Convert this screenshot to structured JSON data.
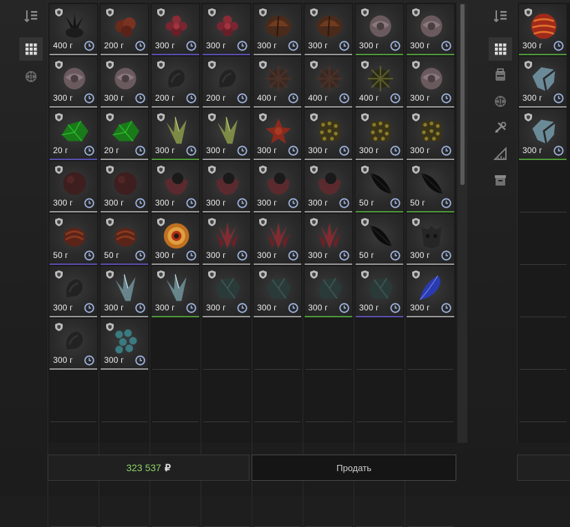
{
  "colors": {
    "background": "#1e1e1e",
    "rarity_green": "#4f9a3a",
    "rarity_purple": "#5a4fb0",
    "rarity_gray": "#9a9a9a",
    "money_green": "#8fd36a"
  },
  "left_tabs": [
    {
      "icon": "sort-icon",
      "active": false
    },
    {
      "icon": "grid-icon",
      "active": true
    },
    {
      "icon": "artifact-icon",
      "active": false
    }
  ],
  "right_tabs": [
    {
      "icon": "sort-icon",
      "active": false
    },
    {
      "icon": "grid-icon",
      "active": true
    },
    {
      "icon": "backpack-icon",
      "active": false
    },
    {
      "icon": "artifact-icon",
      "active": false
    },
    {
      "icon": "tools-icon",
      "active": false
    },
    {
      "icon": "ruler-icon",
      "active": false
    },
    {
      "icon": "box-icon",
      "active": false
    }
  ],
  "inventory": {
    "items": [
      {
        "weight": "400 г",
        "rarity": "gray",
        "art": "black-spikes"
      },
      {
        "weight": "200 г",
        "rarity": "gray",
        "art": "red-clump"
      },
      {
        "weight": "300 г",
        "rarity": "purple",
        "art": "red-flower"
      },
      {
        "weight": "300 г",
        "rarity": "purple",
        "art": "red-flower"
      },
      {
        "weight": "300 г",
        "rarity": "gray",
        "art": "orange-shell"
      },
      {
        "weight": "300 г",
        "rarity": "gray",
        "art": "orange-shell"
      },
      {
        "weight": "300 г",
        "rarity": "green",
        "art": "pale-rose"
      },
      {
        "weight": "300 г",
        "rarity": "green",
        "art": "pale-rose"
      },
      {
        "weight": "300 г",
        "rarity": "gray",
        "art": "pale-rose"
      },
      {
        "weight": "300 г",
        "rarity": "gray",
        "art": "pale-rose"
      },
      {
        "weight": "200 г",
        "rarity": "gray",
        "art": "dark-twist"
      },
      {
        "weight": "200 г",
        "rarity": "gray",
        "art": "dark-twist"
      },
      {
        "weight": "400 г",
        "rarity": "gray",
        "art": "brown-burst"
      },
      {
        "weight": "400 г",
        "rarity": "gray",
        "art": "brown-burst"
      },
      {
        "weight": "400 г",
        "rarity": "gray",
        "art": "olive-burst"
      },
      {
        "weight": "300 г",
        "rarity": "gray",
        "art": "pale-rose"
      },
      {
        "weight": "20 г",
        "rarity": "purple",
        "art": "green-crystal"
      },
      {
        "weight": "20 г",
        "rarity": "gray",
        "art": "green-crystal"
      },
      {
        "weight": "300 г",
        "rarity": "green",
        "art": "yellow-shard"
      },
      {
        "weight": "300 г",
        "rarity": "gray",
        "art": "yellow-shard"
      },
      {
        "weight": "300 г",
        "rarity": "gray",
        "art": "red-star"
      },
      {
        "weight": "300 г",
        "rarity": "gray",
        "art": "gold-nugget"
      },
      {
        "weight": "300 г",
        "rarity": "gray",
        "art": "gold-nugget"
      },
      {
        "weight": "300 г",
        "rarity": "gray",
        "art": "gold-nugget"
      },
      {
        "weight": "300 г",
        "rarity": "gray",
        "art": "maroon-ball"
      },
      {
        "weight": "300 г",
        "rarity": "gray",
        "art": "maroon-ball"
      },
      {
        "weight": "300 г",
        "rarity": "gray",
        "art": "pink-clump"
      },
      {
        "weight": "300 г",
        "rarity": "gray",
        "art": "pink-clump"
      },
      {
        "weight": "300 г",
        "rarity": "gray",
        "art": "pink-clump"
      },
      {
        "weight": "300 г",
        "rarity": "gray",
        "art": "pink-clump"
      },
      {
        "weight": "50 г",
        "rarity": "green",
        "art": "black-leaf"
      },
      {
        "weight": "50 г",
        "rarity": "green",
        "art": "black-leaf"
      },
      {
        "weight": "50 г",
        "rarity": "purple",
        "art": "red-shell"
      },
      {
        "weight": "50 г",
        "rarity": "purple",
        "art": "red-shell"
      },
      {
        "weight": "300 г",
        "rarity": "gray",
        "art": "orange-swirl"
      },
      {
        "weight": "300 г",
        "rarity": "gray",
        "art": "red-crystal"
      },
      {
        "weight": "300 г",
        "rarity": "gray",
        "art": "red-crystal"
      },
      {
        "weight": "300 г",
        "rarity": "gray",
        "art": "red-crystal"
      },
      {
        "weight": "50 г",
        "rarity": "gray",
        "art": "black-leaf"
      },
      {
        "weight": "300 г",
        "rarity": "gray",
        "art": "dark-face"
      },
      {
        "weight": "300 г",
        "rarity": "gray",
        "art": "dark-twist"
      },
      {
        "weight": "300 г",
        "rarity": "gray",
        "art": "ice-crystal"
      },
      {
        "weight": "300 г",
        "rarity": "green",
        "art": "ice-crystal"
      },
      {
        "weight": "300 г",
        "rarity": "gray",
        "art": "teal-rock"
      },
      {
        "weight": "300 г",
        "rarity": "gray",
        "art": "teal-rock"
      },
      {
        "weight": "300 г",
        "rarity": "green",
        "art": "teal-rock"
      },
      {
        "weight": "300 г",
        "rarity": "purple",
        "art": "teal-rock"
      },
      {
        "weight": "300 г",
        "rarity": "gray",
        "art": "blue-feather"
      },
      {
        "weight": "300 г",
        "rarity": "gray",
        "art": "dark-twist"
      },
      {
        "weight": "300 г",
        "rarity": "gray",
        "art": "teal-dots"
      }
    ],
    "empty_slots": 30
  },
  "right_inventory": {
    "items": [
      {
        "weight": "300 г",
        "rarity": "green",
        "art": "red-sphere"
      },
      {
        "weight": "300 г",
        "rarity": "gray",
        "art": "blue-thorn"
      },
      {
        "weight": "300 г",
        "rarity": "green",
        "art": "blue-thorn"
      }
    ]
  },
  "footer": {
    "balance": "323 537",
    "currency": "₽",
    "sell_label": "Продать"
  }
}
